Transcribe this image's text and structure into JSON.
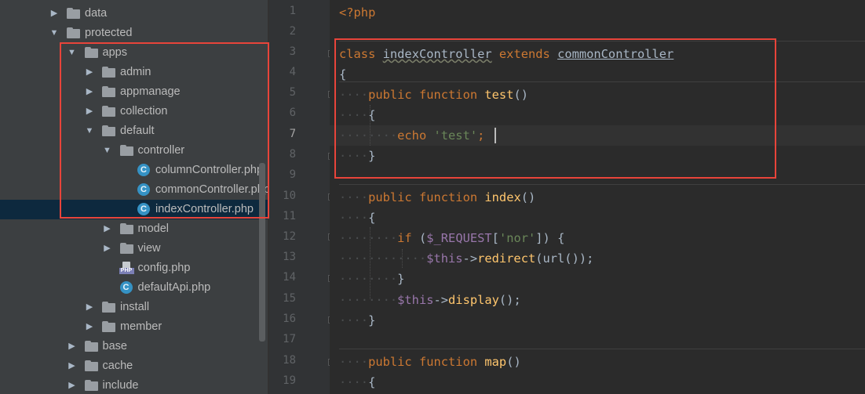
{
  "project_tree": {
    "items": [
      {
        "label": "data",
        "icon": "folder-icon",
        "expanded": false
      },
      {
        "label": "protected",
        "icon": "folder-icon",
        "expanded": true
      },
      {
        "label": "apps",
        "icon": "folder-icon",
        "expanded": true
      },
      {
        "label": "admin",
        "icon": "folder-icon",
        "expanded": false
      },
      {
        "label": "appmanage",
        "icon": "folder-icon",
        "expanded": false
      },
      {
        "label": "collection",
        "icon": "folder-icon",
        "expanded": false
      },
      {
        "label": "default",
        "icon": "folder-icon",
        "expanded": true
      },
      {
        "label": "controller",
        "icon": "folder-icon",
        "expanded": true
      },
      {
        "label": "columnController.php",
        "icon": "php-class-icon",
        "badge": "C"
      },
      {
        "label": "commonController.php",
        "icon": "php-class-icon",
        "badge": "C"
      },
      {
        "label": "indexController.php",
        "icon": "php-class-icon",
        "badge": "C",
        "selected": true
      },
      {
        "label": "model",
        "icon": "folder-icon",
        "expanded": false
      },
      {
        "label": "view",
        "icon": "folder-icon",
        "expanded": false
      },
      {
        "label": "config.php",
        "icon": "php-file-icon",
        "badge": "PHP"
      },
      {
        "label": "defaultApi.php",
        "icon": "php-class-icon",
        "badge": "C"
      },
      {
        "label": "install",
        "icon": "folder-icon",
        "expanded": false
      },
      {
        "label": "member",
        "icon": "folder-icon",
        "expanded": false
      },
      {
        "label": "base",
        "icon": "folder-icon",
        "expanded": false
      },
      {
        "label": "cache",
        "icon": "folder-icon",
        "expanded": false
      },
      {
        "label": "include",
        "icon": "folder-icon",
        "expanded": false
      }
    ]
  },
  "editor": {
    "current_line": "7",
    "line_numbers": [
      "1",
      "2",
      "3",
      "4",
      "5",
      "6",
      "7",
      "8",
      "9",
      "10",
      "11",
      "12",
      "13",
      "14",
      "15",
      "16",
      "17",
      "18",
      "19"
    ],
    "code": {
      "l1_open_tag": "<?php",
      "l3_class_kw": "class",
      "l3_class_name": "indexController",
      "l3_extends_kw": "extends",
      "l3_parent_name": "commonController",
      "l4_brace": "{",
      "l5_public": "public",
      "l5_function": "function",
      "l5_name": "test",
      "l5_parens": "()",
      "l6_brace": "{",
      "l7_echo": "echo",
      "l7_string": "'test'",
      "l7_semi": ";",
      "l8_brace": "}",
      "l10_public": "public",
      "l10_function": "function",
      "l10_name": "index",
      "l10_parens": "()",
      "l11_brace": "{",
      "l12_if": "if",
      "l12_open": "(",
      "l12_var": "$_REQUEST",
      "l12_bracket_open": "[",
      "l12_key": "'nor'",
      "l12_rest": "]) {",
      "l13_this": "$this",
      "l13_arrow": "->",
      "l13_method": "redirect",
      "l13_rest": "(url());",
      "l14_brace": "}",
      "l15_this": "$this",
      "l15_arrow": "->",
      "l15_method": "display",
      "l15_rest": "();",
      "l16_brace": "}",
      "l18_public": "public",
      "l18_function": "function",
      "l18_name": "map",
      "l18_parens": "()",
      "l19_brace": "{"
    }
  },
  "colors": {
    "highlight_box": "#e8443a",
    "keyword": "#cc7832",
    "function_name": "#ffc66d",
    "string": "#6a8759",
    "variable": "#9876aa",
    "tree_bg": "#3c3f41",
    "editor_bg": "#2b2b2b",
    "selection": "#0d293e"
  }
}
